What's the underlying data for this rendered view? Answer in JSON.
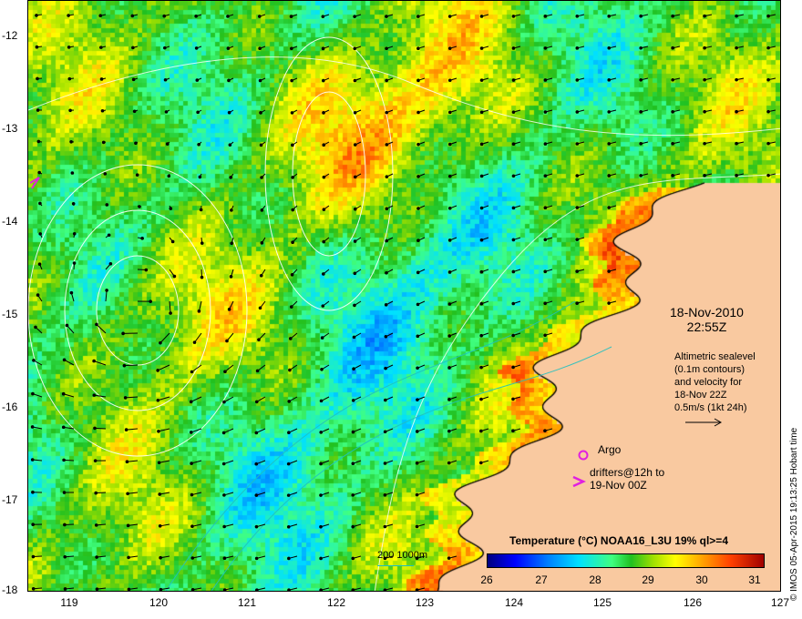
{
  "y_ticks": [
    "-12",
    "-13",
    "-14",
    "-15",
    "-16",
    "-17",
    "-18"
  ],
  "x_ticks": [
    "119",
    "120",
    "121",
    "122",
    "123",
    "124",
    "125",
    "126",
    "127"
  ],
  "date_line1": "18-Nov-2010",
  "date_line2": "22:55Z",
  "altimetry_lines": [
    "Altimetric sealevel",
    "(0.1m contours)",
    "and velocity for",
    "18-Nov 22Z",
    "0.5m/s (1kt 24h)"
  ],
  "argo_label": "Argo",
  "drifter_line1": "drifters@12h to",
  "drifter_line2": "19-Nov 00Z",
  "colorbar_title": "Temperature (°C) NOAA16_L3U 19% ql>=4",
  "colorbar_ticks": [
    "26",
    "27",
    "28",
    "29",
    "30",
    "31"
  ],
  "bathymetry_label": "200  1000m",
  "credit": "© IMOS 05-Apr-2015 19:13:25 Hobart time",
  "colors": {
    "land": "#f9c9a0",
    "coast": "#000000",
    "contour": "#ffffff",
    "bathy": "#20c0c0",
    "argo": "#e020e0",
    "arrow": "#000000"
  }
}
